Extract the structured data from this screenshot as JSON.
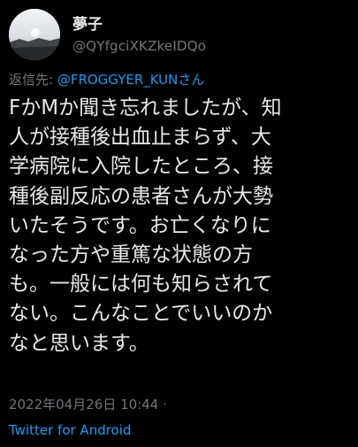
{
  "user": {
    "display_name": "夢子",
    "handle": "@QYfgciXKZkeIDQo",
    "avatar_icon": "profile-photo-sky-landscape"
  },
  "reply": {
    "prefix": "返信先: ",
    "mention": "@FROGGYER_KUN",
    "suffix": "さん"
  },
  "tweet": {
    "lines": [
      "FかMか聞き忘れましたが、知",
      "人が接種後出血止まらず、大",
      "学病院に入院したところ、接",
      "種後副反応の患者さんが大勢",
      "いたそうです。お亡くなりに",
      "なった方や重篤な状態の方",
      "も。一般には何も知らされて",
      "ない。こんなことでいいのか",
      "なと思います。"
    ]
  },
  "meta": {
    "timestamp": "2022年04月26日 10:44 ·",
    "source": "Twitter for Android"
  },
  "colors": {
    "background": "#000000",
    "text": "#e7e9ea",
    "secondary": "#71767b",
    "link": "#1d9bf0"
  }
}
